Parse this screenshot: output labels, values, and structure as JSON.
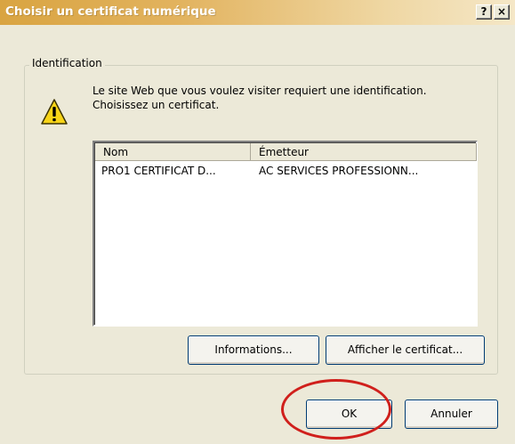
{
  "dialog": {
    "title": "Choisir un certificat numérique",
    "help_label": "?",
    "close_label": "×"
  },
  "group": {
    "legend": "Identification",
    "message": "Le site Web que vous voulez visiter requiert une identification. Choisissez un certificat.",
    "icon": "warning-icon"
  },
  "list": {
    "columns": [
      "Nom",
      "Émetteur"
    ],
    "rows": [
      {
        "name": "PRO1 CERTIFICAT D...",
        "issuer": "AC SERVICES PROFESSIONN..."
      }
    ]
  },
  "buttons": {
    "informations": "Informations...",
    "view_certificate": "Afficher le certificat...",
    "ok": "OK",
    "cancel": "Annuler"
  },
  "colors": {
    "title_start": "#d9a441",
    "title_end": "#f5e7c7",
    "dialog_bg": "#ece9d8",
    "highlight": "#d0201c"
  }
}
